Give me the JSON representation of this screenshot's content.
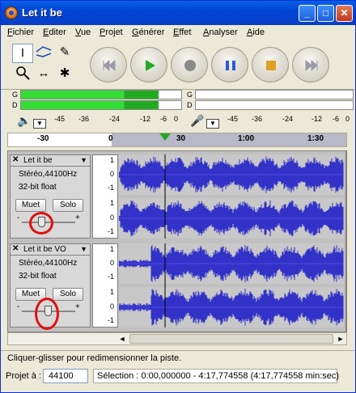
{
  "window": {
    "title": "Let it be",
    "controls": [
      "_",
      "□",
      "✕"
    ]
  },
  "menu": [
    "Fichier",
    "Editer",
    "Vue",
    "Projet",
    "Générer",
    "Effet",
    "Analyser",
    "Aide"
  ],
  "meters": {
    "channel_left": "G",
    "channel_right": "D",
    "playback_scale": [
      "-45",
      "-36",
      "-24",
      "-12",
      "-6",
      "0"
    ],
    "record_scale": [
      "-45",
      "-36",
      "-24",
      "-12",
      "-6",
      "0"
    ],
    "playback_level_fraction": 0.86,
    "colors": {
      "meter_green": "#33dd33",
      "meter_dark": "#22aa22"
    }
  },
  "ruler": {
    "ticks": [
      "-30",
      "0",
      "30",
      "1:00",
      "1:30"
    ]
  },
  "tracks": [
    {
      "name": "Let it be",
      "format": "Stéréo,44100Hz",
      "depth": "32-bit float",
      "mute": "Muet",
      "solo": "Solo",
      "gain_min": "-",
      "gain_max": "+",
      "scale": [
        "1",
        "0",
        "-1",
        "1",
        "0",
        "-1"
      ]
    },
    {
      "name": "Let it be VO",
      "format": "Stéréo,44100Hz",
      "depth": "32-bit float",
      "mute": "Muet",
      "solo": "Solo",
      "gain_min": "-",
      "gain_max": "+",
      "scale": [
        "1",
        "0",
        "-1",
        "1",
        "0",
        "-1"
      ]
    }
  ],
  "status": {
    "hint": "Cliquer-glisser pour redimensionner la piste.",
    "rate_label": "Projet à :",
    "rate_value": "44100",
    "selection": "Sélection : 0:00,000000 - 4:17,774558 (4:17,774558 min:sec)"
  },
  "colors": {
    "waveform": "#3232c8",
    "annotation": "#e01010",
    "title_bar": "#0a5fe3"
  }
}
